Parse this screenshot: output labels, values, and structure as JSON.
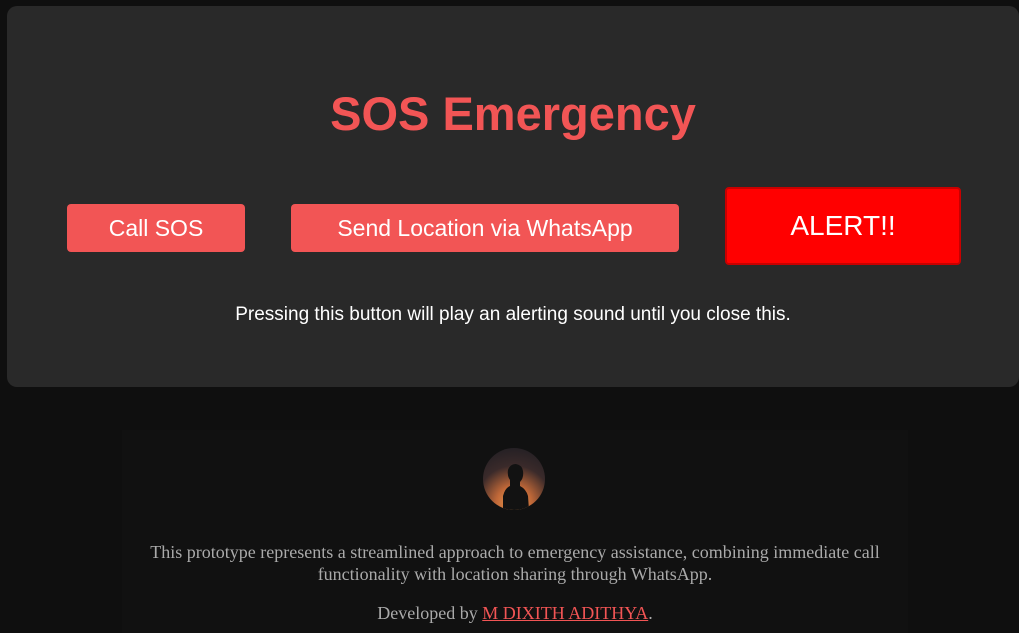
{
  "header": {
    "title": "SOS Emergency"
  },
  "actions": {
    "call_label": "Call SOS",
    "whatsapp_label": "Send Location via WhatsApp",
    "alert_label": "ALERT!!",
    "alert_note": "Pressing this button will play an alerting sound until you close this."
  },
  "footer": {
    "avatar_icon": "profile-photo",
    "description": "This prototype represents a streamlined approach to emergency assistance, combining immediate call functionality with location sharing through WhatsApp.",
    "credit_prefix": "Developed by ",
    "author": "M DIXITH ADITHYA",
    "credit_suffix": "."
  },
  "colors": {
    "accent": "#f25555",
    "alert": "#ff0000",
    "card_bg": "#292929",
    "page_bg": "#0f0f0f"
  }
}
